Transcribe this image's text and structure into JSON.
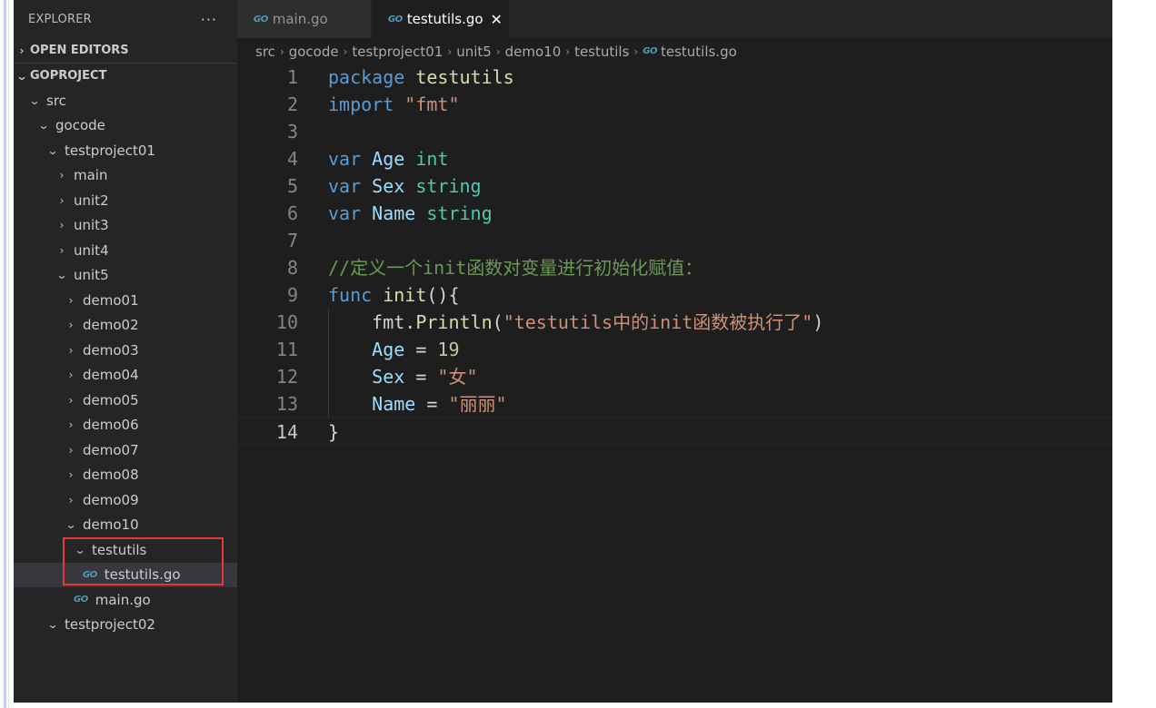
{
  "sidebar": {
    "title": "EXPLORER",
    "more_icon": "ellipsis-icon",
    "open_editors": "OPEN EDITORS",
    "project": "GOPROJECT",
    "tree": [
      {
        "label": "src",
        "depth": 0,
        "expanded": true
      },
      {
        "label": "gocode",
        "depth": 1,
        "expanded": true
      },
      {
        "label": "testproject01",
        "depth": 2,
        "expanded": true
      },
      {
        "label": "main",
        "depth": 3,
        "expanded": false
      },
      {
        "label": "unit2",
        "depth": 3,
        "expanded": false
      },
      {
        "label": "unit3",
        "depth": 3,
        "expanded": false
      },
      {
        "label": "unit4",
        "depth": 3,
        "expanded": false
      },
      {
        "label": "unit5",
        "depth": 3,
        "expanded": true
      },
      {
        "label": "demo01",
        "depth": 4,
        "expanded": false
      },
      {
        "label": "demo02",
        "depth": 4,
        "expanded": false
      },
      {
        "label": "demo03",
        "depth": 4,
        "expanded": false
      },
      {
        "label": "demo04",
        "depth": 4,
        "expanded": false
      },
      {
        "label": "demo05",
        "depth": 4,
        "expanded": false
      },
      {
        "label": "demo06",
        "depth": 4,
        "expanded": false
      },
      {
        "label": "demo07",
        "depth": 4,
        "expanded": false
      },
      {
        "label": "demo08",
        "depth": 4,
        "expanded": false
      },
      {
        "label": "demo09",
        "depth": 4,
        "expanded": false
      },
      {
        "label": "demo10",
        "depth": 4,
        "expanded": true
      },
      {
        "label": "testutils",
        "depth": 5,
        "expanded": true
      },
      {
        "label": "testutils.go",
        "depth": 6,
        "file": true,
        "selected": true
      },
      {
        "label": "main.go",
        "depth": 5,
        "file": true
      },
      {
        "label": "testproject02",
        "depth": 2,
        "expanded": true
      }
    ]
  },
  "tabs": [
    {
      "label": "main.go",
      "icon": "go-file-icon",
      "active": false
    },
    {
      "label": "testutils.go",
      "icon": "go-file-icon",
      "active": true,
      "close": "✕"
    }
  ],
  "file_icon_text": "GO",
  "breadcrumb": [
    "src",
    "gocode",
    "testproject01",
    "unit5",
    "demo10",
    "testutils",
    "testutils.go"
  ],
  "breadcrumb_sep": "›",
  "editor": {
    "current_line": 14,
    "lines": [
      {
        "n": "1",
        "tokens": [
          [
            "kw",
            "package"
          ],
          [
            "src",
            " "
          ],
          [
            "fn2",
            "testutils"
          ]
        ]
      },
      {
        "n": "2",
        "tokens": [
          [
            "kw",
            "import"
          ],
          [
            "src",
            " "
          ],
          [
            "str",
            "\"fmt\""
          ]
        ]
      },
      {
        "n": "3",
        "tokens": []
      },
      {
        "n": "4",
        "tokens": [
          [
            "kw",
            "var"
          ],
          [
            "src",
            " "
          ],
          [
            "vr",
            "Age"
          ],
          [
            "src",
            " "
          ],
          [
            "ty",
            "int"
          ]
        ]
      },
      {
        "n": "5",
        "tokens": [
          [
            "kw",
            "var"
          ],
          [
            "src",
            " "
          ],
          [
            "vr",
            "Sex"
          ],
          [
            "src",
            " "
          ],
          [
            "ty",
            "string"
          ]
        ]
      },
      {
        "n": "6",
        "tokens": [
          [
            "kw",
            "var"
          ],
          [
            "src",
            " "
          ],
          [
            "vr",
            "Name"
          ],
          [
            "src",
            " "
          ],
          [
            "ty",
            "string"
          ]
        ]
      },
      {
        "n": "7",
        "tokens": []
      },
      {
        "n": "8",
        "tokens": [
          [
            "cm",
            "//定义一个init函数对变量进行初始化赋值："
          ]
        ]
      },
      {
        "n": "9",
        "tokens": [
          [
            "kw",
            "func"
          ],
          [
            "src",
            " "
          ],
          [
            "fn",
            "init"
          ],
          [
            "br",
            "(){"
          ]
        ]
      },
      {
        "n": "10",
        "tokens": [
          [
            "src",
            "    "
          ],
          [
            "src",
            "fmt."
          ],
          [
            "fn",
            "Println"
          ],
          [
            "br",
            "("
          ],
          [
            "str",
            "\"testutils中的init函数被执行了\""
          ],
          [
            "br",
            ")"
          ]
        ]
      },
      {
        "n": "11",
        "tokens": [
          [
            "src",
            "    "
          ],
          [
            "vr",
            "Age"
          ],
          [
            "src",
            " = "
          ],
          [
            "num",
            "19"
          ]
        ]
      },
      {
        "n": "12",
        "tokens": [
          [
            "src",
            "    "
          ],
          [
            "vr",
            "Sex"
          ],
          [
            "src",
            " = "
          ],
          [
            "str",
            "\"女\""
          ]
        ]
      },
      {
        "n": "13",
        "tokens": [
          [
            "src",
            "    "
          ],
          [
            "vr",
            "Name"
          ],
          [
            "src",
            " = "
          ],
          [
            "str",
            "\"丽丽\""
          ]
        ]
      },
      {
        "n": "14",
        "tokens": [
          [
            "br",
            "}"
          ]
        ]
      }
    ]
  },
  "colors": {
    "keyword": "#569cd6",
    "type": "#4ec9b0",
    "variable": "#9cdcfe",
    "string": "#ce9178",
    "number": "#b5cea8",
    "comment": "#6a9955",
    "function": "#dcdcaa",
    "highlight_box": "#e53935"
  }
}
